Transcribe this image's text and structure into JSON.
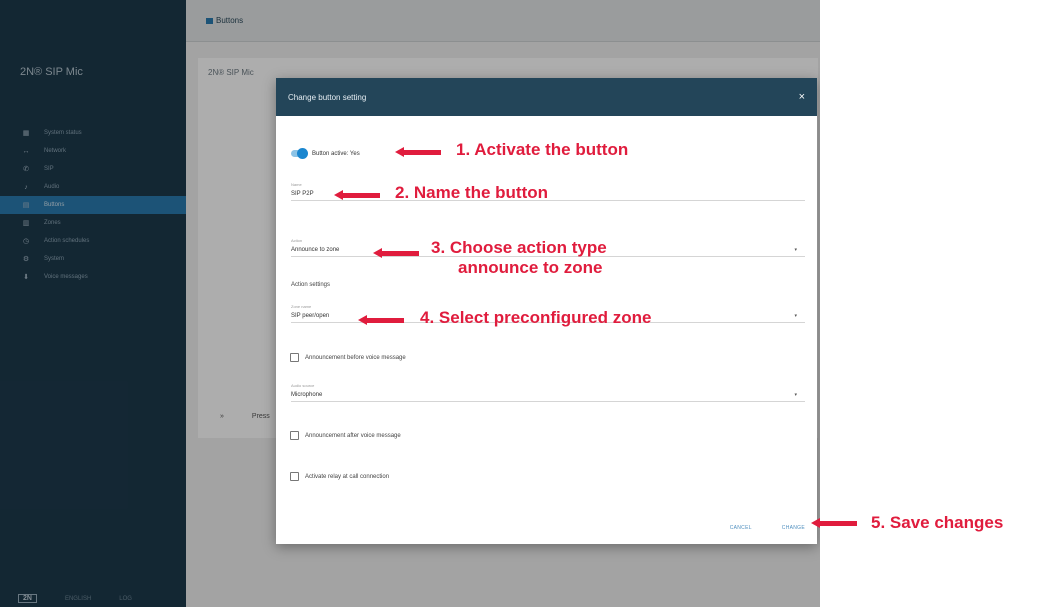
{
  "app": {
    "brand": "2N® SIP Mic",
    "page_title": "Buttons",
    "device_name": "2N® SIP Mic",
    "sidebar": {
      "items": [
        {
          "icon": "▦",
          "label": "System status"
        },
        {
          "icon": "↔",
          "label": "Network"
        },
        {
          "icon": "✆",
          "label": "SIP"
        },
        {
          "icon": "♪",
          "label": "Audio"
        },
        {
          "icon": "▤",
          "label": "Buttons"
        },
        {
          "icon": "▥",
          "label": "Zones"
        },
        {
          "icon": "◷",
          "label": "Action schedules"
        },
        {
          "icon": "⚙",
          "label": "System"
        },
        {
          "icon": "⬇",
          "label": "Voice messages"
        }
      ],
      "footer": {
        "logo": "2N",
        "lang": "ENGLISH",
        "logout": "LOG"
      }
    },
    "background_row": {
      "arrow": "»",
      "text": "Press"
    }
  },
  "dialog": {
    "title": "Change button setting",
    "close": "×",
    "toggle_label": "Button active: Yes",
    "name_field": {
      "label": "Name",
      "value": "SIP P2P"
    },
    "action_field": {
      "label": "Action",
      "value": "Announce to zone"
    },
    "action_settings_label": "Action settings",
    "zone_field": {
      "label": "Zone name",
      "value": "SIP peer/open"
    },
    "check_before": "Announcement before voice message",
    "audio_field": {
      "label": "Audio source",
      "value": "Microphone"
    },
    "check_after": "Announcement after voice message",
    "check_relay": "Activate relay at call connection",
    "cancel": "CANCEL",
    "change": "CHANGE",
    "dropdown_icon": "▾"
  },
  "annotations": {
    "step1": "1. Activate the button",
    "step2": "2. Name the button",
    "step3_line1": "3. Choose action type",
    "step3_line2": "announce to zone",
    "step4": "4. Select preconfigured zone",
    "step5": "5. Save changes",
    "color": "#e01c3d"
  }
}
